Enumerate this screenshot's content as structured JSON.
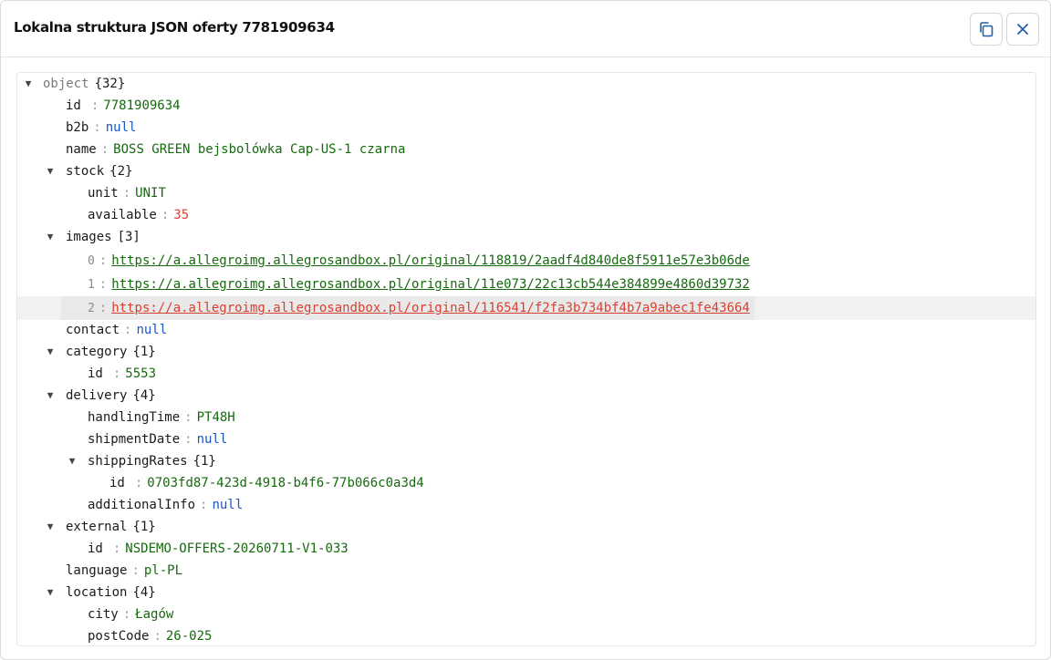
{
  "dialog": {
    "title": "Lokalna struktura JSON oferty 7781909634",
    "copy_icon": "copy-icon",
    "close_icon": "close-icon"
  },
  "tree": {
    "root_label": "object",
    "root_count": "{32}",
    "id": "7781909634",
    "b2b": "null",
    "name": "BOSS GREEN bejsbolówka Cap-US-1 czarna",
    "stock": {
      "count": "{2}",
      "unit": "UNIT",
      "available": "35"
    },
    "images": {
      "count": "[3]",
      "items": [
        "https://a.allegroimg.allegrosandbox.pl/original/118819/2aadf4d840de8f5911e57e3b06de",
        "https://a.allegroimg.allegrosandbox.pl/original/11e073/22c13cb544e384899e4860d39732",
        "https://a.allegroimg.allegrosandbox.pl/original/116541/f2fa3b734bf4b7a9abec1fe43664"
      ]
    },
    "contact": "null",
    "category": {
      "count": "{1}",
      "id": "5553"
    },
    "delivery": {
      "count": "{4}",
      "handlingTime": "PT48H",
      "shipmentDate": "null",
      "shippingRates_count": "{1}",
      "shippingRates_id": "0703fd87-423d-4918-b4f6-77b066c0a3d4",
      "additionalInfo": "null"
    },
    "external": {
      "count": "{1}",
      "id": "NSDEMO-OFFERS-20260711-V1-033"
    },
    "language": "pl-PL",
    "location": {
      "count": "{4}",
      "city": "Łagów",
      "postCode": "26-025"
    }
  },
  "keys": {
    "id": "id",
    "b2b": "b2b",
    "name": "name",
    "stock": "stock",
    "unit": "unit",
    "available": "available",
    "images": "images",
    "contact": "contact",
    "category": "category",
    "delivery": "delivery",
    "handlingTime": "handlingTime",
    "shipmentDate": "shipmentDate",
    "shippingRates": "shippingRates",
    "additionalInfo": "additionalInfo",
    "external": "external",
    "language": "language",
    "location": "location",
    "city": "city",
    "postCode": "postCode",
    "idx0": "0",
    "idx1": "1",
    "idx2": "2"
  },
  "colors": {
    "string": "#16690f",
    "null": "#1b54c4",
    "number": "#d84032",
    "highlight": "#f2f2f2"
  }
}
